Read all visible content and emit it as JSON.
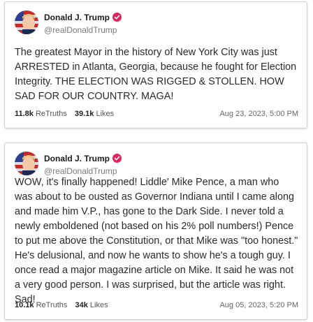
{
  "posts": [
    {
      "author": {
        "name": "Donald J. Trump",
        "handle": "@realDonaldTrump",
        "verified_icon": "verified-badge-icon",
        "badge_color": "#e0245e"
      },
      "text": "The greatest Mayor in the history of New York City was just ARRESTED in Atlanta, Georgia, because he fought for Election Integrity. THE ELECTION WAS RIGGED & STOLLEN. HOW SAD FOR OUR COUNTRY. MAGA!",
      "retruths_count": "11.8k",
      "retruths_label": "ReTruths",
      "likes_count": "39.1k",
      "likes_label": "Likes",
      "timestamp": "Aug 23, 2023, 5:00 PM"
    },
    {
      "author": {
        "name": "Donald J. Trump",
        "handle": "@realDonaldTrump",
        "verified_icon": "verified-badge-icon",
        "badge_color": "#e0245e"
      },
      "text": "WOW, it's finally happened! Liddle' Mike Pence, a man who was about to be ousted as Governor Indiana until I came along and made him V.P., has gone to the Dark Side. I never told a newly emboldened (not based on his 2% poll numbers!) Pence to put me above the Constitution, or that Mike was \"too honest.\" He's delusional, and now he wants to show he's a tough guy. I once read a major magazine article on Mike. It said he was not a very good person. I was surprised, but the article was right. Sad!",
      "retruths_count": "10.1k",
      "retruths_label": "ReTruths",
      "likes_count": "34k",
      "likes_label": "Likes",
      "timestamp": "Aug 05, 2023, 5:20 PM"
    }
  ]
}
